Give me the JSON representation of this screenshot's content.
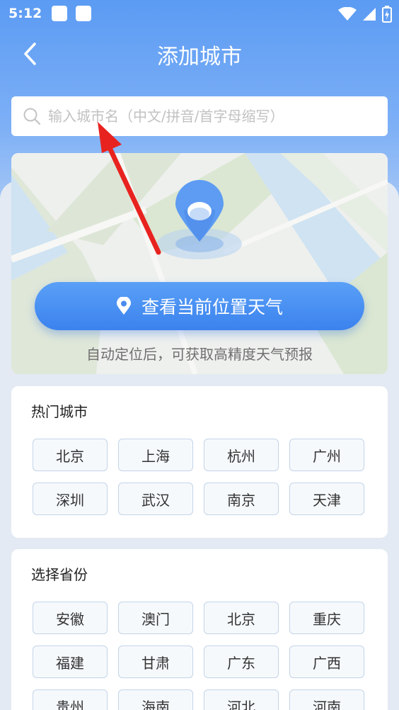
{
  "status_bar": {
    "time": "5:12"
  },
  "header": {
    "title": "添加城市",
    "back_icon": "chevron-left-icon"
  },
  "search": {
    "placeholder": "输入城市名（中文/拼音/首字母缩写）",
    "value": ""
  },
  "location": {
    "button_label": "查看当前位置天气",
    "hint": "自动定位后，可获取高精度天气预报"
  },
  "hot_cities": {
    "title": "热门城市",
    "items": [
      "北京",
      "上海",
      "杭州",
      "广州",
      "深圳",
      "武汉",
      "南京",
      "天津"
    ]
  },
  "provinces": {
    "title": "选择省份",
    "items": [
      "安徽",
      "澳门",
      "北京",
      "重庆",
      "福建",
      "甘肃",
      "广东",
      "广西",
      "贵州",
      "海南",
      "河北",
      "河南"
    ]
  },
  "colors": {
    "accent": "#3b82ee",
    "header": "#5b9bf3",
    "arrow": "#e8231f"
  }
}
